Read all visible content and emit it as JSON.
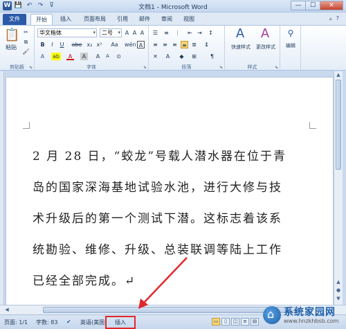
{
  "window": {
    "title": "文档1 - Microsoft Word",
    "qat": [
      "W",
      "💾",
      "↶",
      "↷",
      "⊽"
    ],
    "controls": [
      "—",
      "☐",
      "✕"
    ]
  },
  "tabs": {
    "file": "文件",
    "items": [
      "开始",
      "插入",
      "页面布局",
      "引用",
      "邮件",
      "审阅",
      "视图"
    ],
    "active": "开始",
    "right_icons": [
      "▵",
      "?"
    ]
  },
  "ribbon": {
    "clipboard": {
      "label": "剪贴板",
      "paste": "粘贴"
    },
    "font": {
      "label": "字体",
      "family": "华文楷体",
      "size": "二号",
      "buttons": [
        "A",
        "A",
        "Aa",
        "A",
        "wén",
        "A"
      ],
      "format": [
        "B",
        "I",
        "U",
        "abe",
        "x₂",
        "x²"
      ],
      "colors": [
        "A",
        "ab",
        "A",
        "A",
        "A",
        "A",
        "⊙"
      ]
    },
    "paragraph": {
      "label": "段落"
    },
    "styles": {
      "label": "样式",
      "quick": "快速样式",
      "change": "更改样式"
    },
    "editing": {
      "label": "编辑",
      "text": "编辑"
    }
  },
  "document": {
    "lines": [
      "2 月 28 日，“蛟龙”号载人潜水器在位于青",
      "岛的国家深海基地试验水池，进行大修与技",
      "术升级后的第一个测试下潜。这标志着该系",
      "统勘验、维修、升级、总装联调等陆上工作",
      "已经全部完成。↵"
    ]
  },
  "statusbar": {
    "page": "页面: 1/1",
    "words": "字数: 83",
    "lang": "英语(美国)",
    "insert": "插入"
  },
  "watermark": {
    "name": "系统家园网",
    "url": "www.hnzkhbsb.com"
  },
  "colors": {
    "accent": "#2a5aa8",
    "highlight_box": "#e0282a"
  }
}
